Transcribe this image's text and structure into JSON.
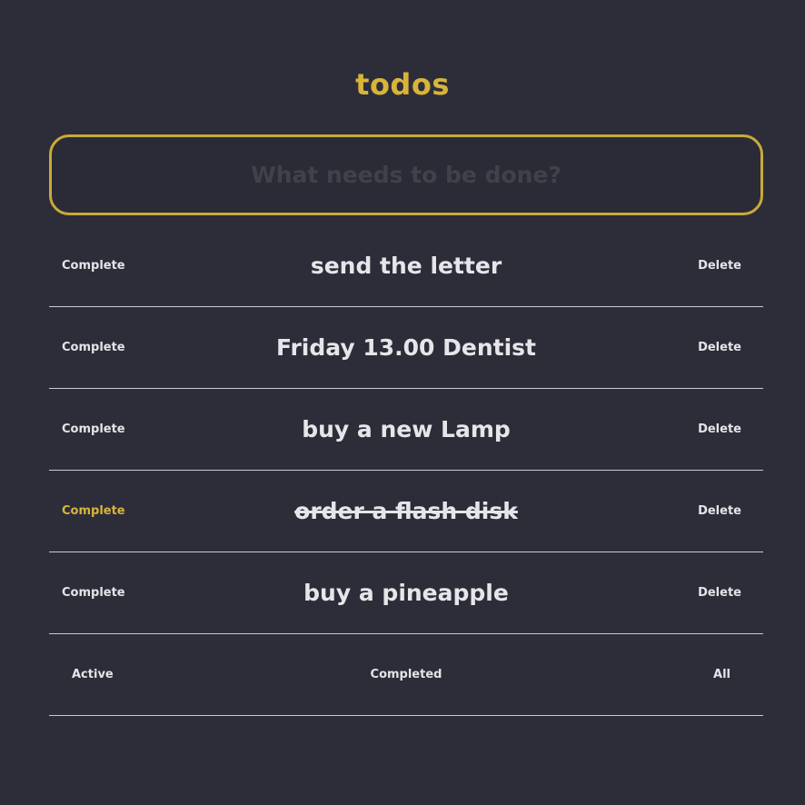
{
  "app": {
    "title": "todos"
  },
  "input": {
    "placeholder": "What needs to be done?",
    "value": ""
  },
  "todos": [
    {
      "text": "send the letter",
      "completed": false,
      "complete_label": "Complete",
      "delete_label": "Delete"
    },
    {
      "text": "Friday 13.00 Dentist",
      "completed": false,
      "complete_label": "Complete",
      "delete_label": "Delete"
    },
    {
      "text": "buy a new Lamp",
      "completed": false,
      "complete_label": "Complete",
      "delete_label": "Delete"
    },
    {
      "text": "order a flash disk",
      "completed": true,
      "complete_label": "Complete",
      "delete_label": "Delete"
    },
    {
      "text": "buy a pineapple",
      "completed": false,
      "complete_label": "Complete",
      "delete_label": "Delete"
    }
  ],
  "filters": {
    "active_label": "Active",
    "completed_label": "Completed",
    "all_label": "All"
  },
  "colors": {
    "background": "#2d2d3a",
    "accent": "#d8b43a",
    "text": "#e6e6ea",
    "divider": "#c9c9cf"
  }
}
